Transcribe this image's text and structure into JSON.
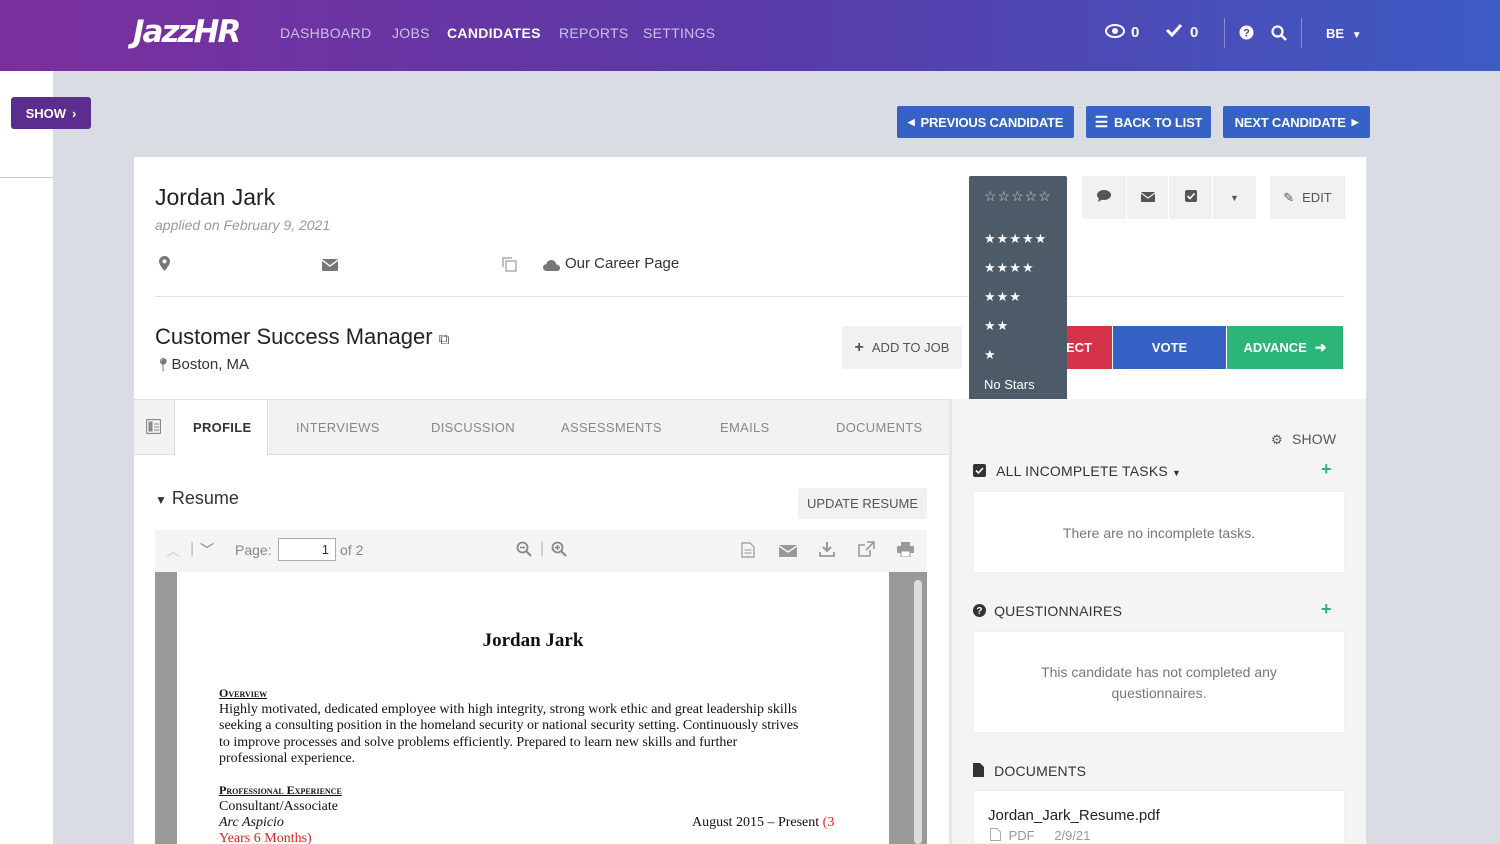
{
  "nav": {
    "logo": "JazzHR",
    "links": [
      "DASHBOARD",
      "JOBS",
      "CANDIDATES",
      "REPORTS",
      "SETTINGS"
    ],
    "active": "CANDIDATES",
    "views_count": "0",
    "checks_count": "0",
    "user_initials": "BE"
  },
  "sidebar": {
    "show_label": "SHOW"
  },
  "pager": {
    "previous": "PREVIOUS CANDIDATE",
    "back": "BACK TO LIST",
    "next": "NEXT CANDIDATE"
  },
  "candidate": {
    "name": "Jordan Jark",
    "applied": "applied on February 9, 2021",
    "source": "Our Career Page",
    "job_title": "Customer Success Manager",
    "location": "Boston, MA"
  },
  "actions": {
    "edit": "EDIT",
    "add_to_job": "ADD TO JOB",
    "reject": "ECT",
    "vote": "VOTE",
    "advance": "ADVANCE"
  },
  "rating": {
    "current": 0,
    "options": [
      "★★★★★",
      "★★★★",
      "★★★",
      "★★",
      "★",
      "No Stars"
    ]
  },
  "tabs": [
    "PROFILE",
    "INTERVIEWS",
    "DISCUSSION",
    "ASSESSMENTS",
    "EMAILS",
    "DOCUMENTS"
  ],
  "resume": {
    "heading": "Resume",
    "update_button": "UPDATE RESUME",
    "page_label": "Page:",
    "page_value": "1",
    "page_total": "of 2",
    "doc": {
      "name": "Jordan Jark",
      "overview_heading": "Overview",
      "overview_lines": [
        "Highly motivated, dedicated employee with high integrity, strong work ethic and great leadership skills",
        "seeking a consulting position in the homeland security or national security setting. Continuously strives",
        "to improve processes and solve problems efficiently. Prepared to learn new skills and further",
        "professional experience."
      ],
      "experience_heading": "Professional Experience",
      "role": "Consultant/Associate",
      "company": "Arc Aspicio",
      "dates": "August 2015 – Present",
      "duration_start": "(3",
      "duration_end": "Years 6 Months)"
    }
  },
  "right": {
    "show_label": "SHOW",
    "tasks_heading": "ALL INCOMPLETE TASKS",
    "tasks_empty": "There are no incomplete tasks.",
    "questionnaires_heading": "QUESTIONNAIRES",
    "questionnaires_empty": "This candidate has not completed any questionnaires.",
    "documents_heading": "DOCUMENTS",
    "document": {
      "name": "Jordan_Jark_Resume.pdf",
      "type": "PDF",
      "date": "2/9/21"
    }
  },
  "colors": {
    "nav_gradient_start": "#7b2f9e",
    "nav_gradient_end": "#3d5bc4",
    "primary_blue": "#3562c4",
    "advance_green": "#2bb577",
    "reject_red": "#d6334b",
    "rating_bg": "#4d5a68"
  }
}
